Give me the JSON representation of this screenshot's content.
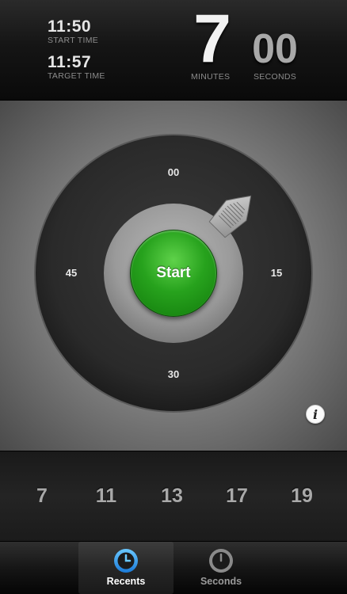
{
  "header": {
    "start_time": "11:50",
    "start_label": "START TIME",
    "target_time": "11:57",
    "target_label": "TARGET TIME",
    "minutes_value": "7",
    "minutes_label": "MINUTES",
    "seconds_value": "00",
    "seconds_label": "SECONDS"
  },
  "dial": {
    "marks": [
      "00",
      "15",
      "30",
      "45"
    ],
    "start_label": "Start",
    "info_label": "i",
    "accent": "#27a21d"
  },
  "presets": [
    "7",
    "11",
    "13",
    "17",
    "19"
  ],
  "tabs": [
    {
      "label": "Recents",
      "icon": "clock-icon",
      "active": true
    },
    {
      "label": "Seconds",
      "icon": "stopwatch-icon",
      "active": false
    }
  ]
}
